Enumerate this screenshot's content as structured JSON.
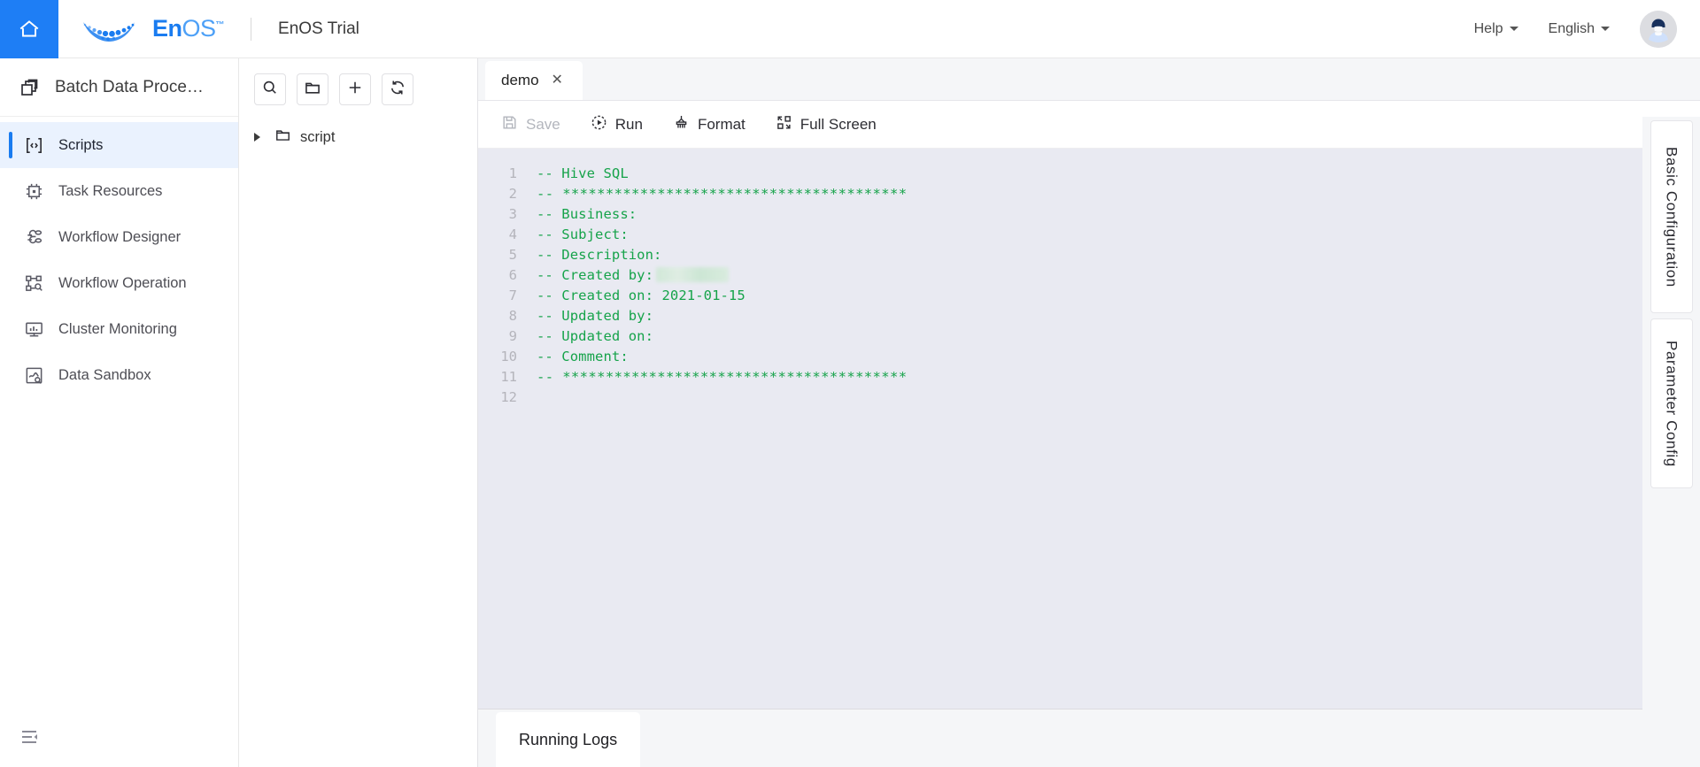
{
  "header": {
    "home_icon": "home-icon",
    "logo_en": "En",
    "logo_os": "OS",
    "logo_tm": "™",
    "product_title": "EnOS Trial",
    "help_label": "Help",
    "language_label": "English",
    "avatar_icon": "user-avatar-icon",
    "accent_color": "#1a7cf0"
  },
  "sidebar": {
    "module_label": "Batch Data Proce…",
    "module_icon": "batch-data-icon",
    "collapse_icon": "menu-fold-icon",
    "items": [
      {
        "label": "Scripts",
        "icon": "scripts-icon",
        "active": true
      },
      {
        "label": "Task Resources",
        "icon": "task-resources-icon",
        "active": false
      },
      {
        "label": "Workflow Designer",
        "icon": "workflow-designer-icon",
        "active": false
      },
      {
        "label": "Workflow Operation",
        "icon": "workflow-operation-icon",
        "active": false
      },
      {
        "label": "Cluster Monitoring",
        "icon": "cluster-monitoring-icon",
        "active": false
      },
      {
        "label": "Data Sandbox",
        "icon": "data-sandbox-icon",
        "active": false
      }
    ]
  },
  "tree_panel": {
    "toolbar": [
      {
        "name": "search-icon",
        "title": "Search"
      },
      {
        "name": "new-folder-icon",
        "title": "New Folder"
      },
      {
        "name": "plus-icon",
        "title": "Add"
      },
      {
        "name": "refresh-icon",
        "title": "Refresh"
      }
    ],
    "nodes": [
      {
        "label": "script",
        "icon": "folder-icon",
        "expanded": false
      }
    ]
  },
  "editor": {
    "tabs": [
      {
        "label": "demo",
        "close": "✕",
        "active": true
      }
    ],
    "toolbar": {
      "save_label": "Save",
      "save_enabled": false,
      "run_label": "Run",
      "format_label": "Format",
      "fullscreen_label": "Full Screen"
    },
    "code_lines": [
      {
        "n": "1",
        "text": "-- Hive SQL"
      },
      {
        "n": "2",
        "text": "-- ****************************************"
      },
      {
        "n": "3",
        "text": "-- Business:"
      },
      {
        "n": "4",
        "text": "-- Subject:"
      },
      {
        "n": "5",
        "text": "-- Description:"
      },
      {
        "n": "6",
        "text": "-- Created by:"
      },
      {
        "n": "7",
        "text": "-- Created on: 2021-01-15"
      },
      {
        "n": "8",
        "text": "-- Updated by:"
      },
      {
        "n": "9",
        "text": "-- Updated on:"
      },
      {
        "n": "10",
        "text": "-- Comment:"
      },
      {
        "n": "11",
        "text": "-- ****************************************"
      },
      {
        "n": "12",
        "text": ""
      }
    ],
    "comment_color": "#16a34a",
    "background_color": "#e9eaf2"
  },
  "bottom_panel": {
    "tabs": [
      {
        "label": "Running Logs",
        "active": true
      }
    ]
  },
  "right_rail": {
    "tabs": [
      {
        "label": "Basic Configuration"
      },
      {
        "label": "Parameter Config"
      }
    ]
  }
}
